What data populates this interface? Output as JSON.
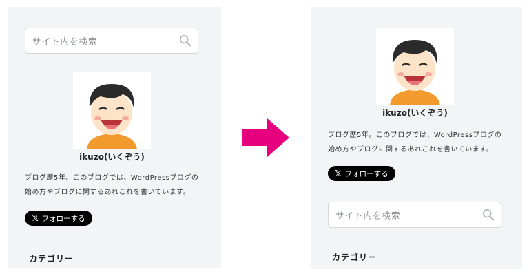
{
  "left": {
    "search": {
      "placeholder": "サイト内を検索",
      "icon": "search-icon"
    },
    "profile": {
      "name": "ikuzo(いくぞう)",
      "bio_line1": "ブログ歴5年。このブログでは、WordPressブログの",
      "bio_line2": "始め方やブログに関するあれこれを書いています。"
    },
    "follow": {
      "logo": "𝕏",
      "label": "フォローする"
    },
    "category_heading": "カテゴリー"
  },
  "right": {
    "profile": {
      "name": "ikuzo(いくぞう)",
      "bio_line1": "ブログ歴5年。このブログでは、WordPressブログの",
      "bio_line2": "始め方やブログに関するあれこれを書いています。"
    },
    "follow": {
      "logo": "𝕏",
      "label": "フォローする"
    },
    "search": {
      "placeholder": "サイト内を検索",
      "icon": "search-icon"
    },
    "category_heading": "カテゴリー"
  },
  "colors": {
    "panel_bg": "#f3f4f6",
    "arrow": "#e6007e",
    "follow_bg": "#000000",
    "avatar_shirt": "#f29a2e"
  },
  "arrow": {
    "icon": "arrow-right-icon"
  }
}
